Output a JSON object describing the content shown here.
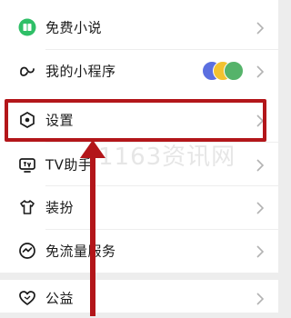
{
  "menu_groups": [
    {
      "items": [
        {
          "label": "免费小说",
          "icon": "book-icon"
        },
        {
          "label": "我的小程序",
          "icon": "mini-program-icon",
          "avatars": [
            "#5b6fe0",
            "#f2c230",
            "#55b36a"
          ]
        }
      ]
    },
    {
      "items": [
        {
          "label": "设置",
          "icon": "settings-hexagon-icon"
        },
        {
          "label": "TV助手",
          "icon": "tv-icon"
        },
        {
          "label": "装扮",
          "icon": "tshirt-icon"
        },
        {
          "label": "免流量服务",
          "icon": "traffic-icon"
        }
      ]
    },
    {
      "items": [
        {
          "label": "公益",
          "icon": "heart-icon"
        }
      ]
    }
  ],
  "watermark": "1163资讯网",
  "annotation": {
    "color": "#b3161a",
    "highlighted_item": "设置"
  },
  "colors": {
    "accent_green": "#2fbf67",
    "icon_dark": "#1a1a1a",
    "chevron": "#b2b2b2"
  }
}
